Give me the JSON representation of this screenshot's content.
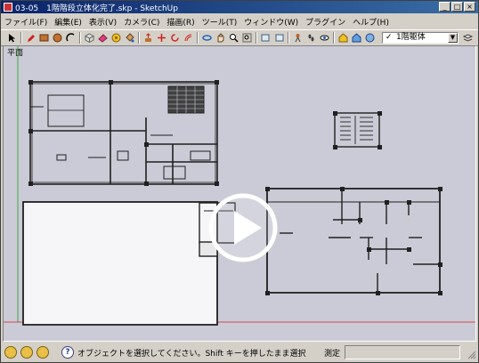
{
  "window": {
    "title": "03-05　1階階段立体化完了.skp - SketchUp"
  },
  "menu": [
    "ファイル(F)",
    "編集(E)",
    "表示(V)",
    "カメラ(C)",
    "描画(R)",
    "ツール(T)",
    "ウィンドウ(W)",
    "プラグイン",
    "ヘルプ(H)"
  ],
  "toolbar": {
    "layer_checked": "✓",
    "layer_value": "1階躯体"
  },
  "canvas": {
    "view_label": "平面"
  },
  "status": {
    "message": "オブジェクトを選択してください。Shift キーを押したまま選択",
    "measure_label": "測定",
    "measure_value": ""
  },
  "colors": {
    "title_start": "#0a246a",
    "title_end": "#3a6ea5",
    "canvas_bg": "#cacbd6",
    "red_axis": "#d02020",
    "green_axis": "#20a020"
  }
}
